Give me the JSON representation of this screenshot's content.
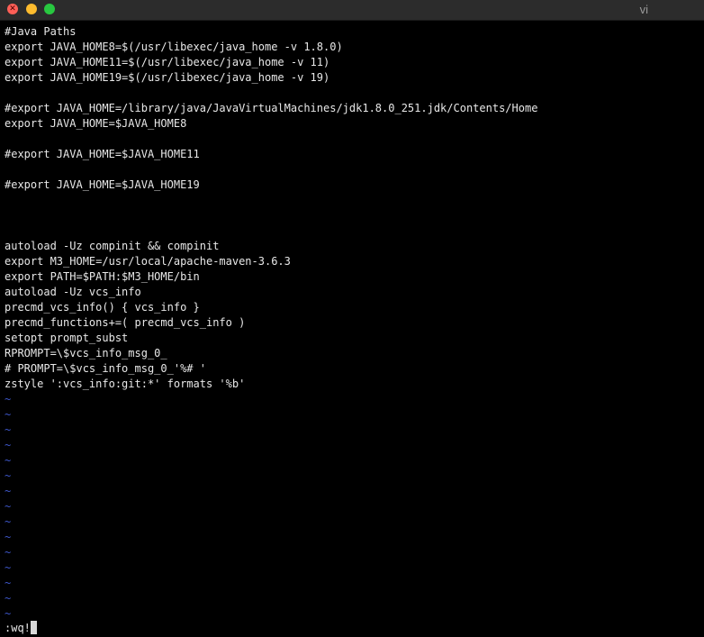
{
  "window": {
    "title": "vi"
  },
  "buffer": {
    "lines": [
      "#Java Paths",
      "export JAVA_HOME8=$(/usr/libexec/java_home -v 1.8.0)",
      "export JAVA_HOME11=$(/usr/libexec/java_home -v 11)",
      "export JAVA_HOME19=$(/usr/libexec/java_home -v 19)",
      "",
      "#export JAVA_HOME=/library/java/JavaVirtualMachines/jdk1.8.0_251.jdk/Contents/Home",
      "export JAVA_HOME=$JAVA_HOME8",
      "",
      "#export JAVA_HOME=$JAVA_HOME11",
      "",
      "#export JAVA_HOME=$JAVA_HOME19",
      "",
      "",
      "",
      "autoload -Uz compinit && compinit",
      "export M3_HOME=/usr/local/apache-maven-3.6.3",
      "export PATH=$PATH:$M3_HOME/bin",
      "autoload -Uz vcs_info",
      "precmd_vcs_info() { vcs_info }",
      "precmd_functions+=( precmd_vcs_info )",
      "setopt prompt_subst",
      "RPROMPT=\\$vcs_info_msg_0_",
      "# PROMPT=\\$vcs_info_msg_0_'%# '",
      "zstyle ':vcs_info:git:*' formats '%b'"
    ],
    "empty_line_marker": "~",
    "empty_line_count": 15
  },
  "command_line": {
    "text": ":wq!"
  },
  "colors": {
    "text": "#e8e8e8",
    "tilde": "#3d56c9",
    "background": "#000000"
  }
}
